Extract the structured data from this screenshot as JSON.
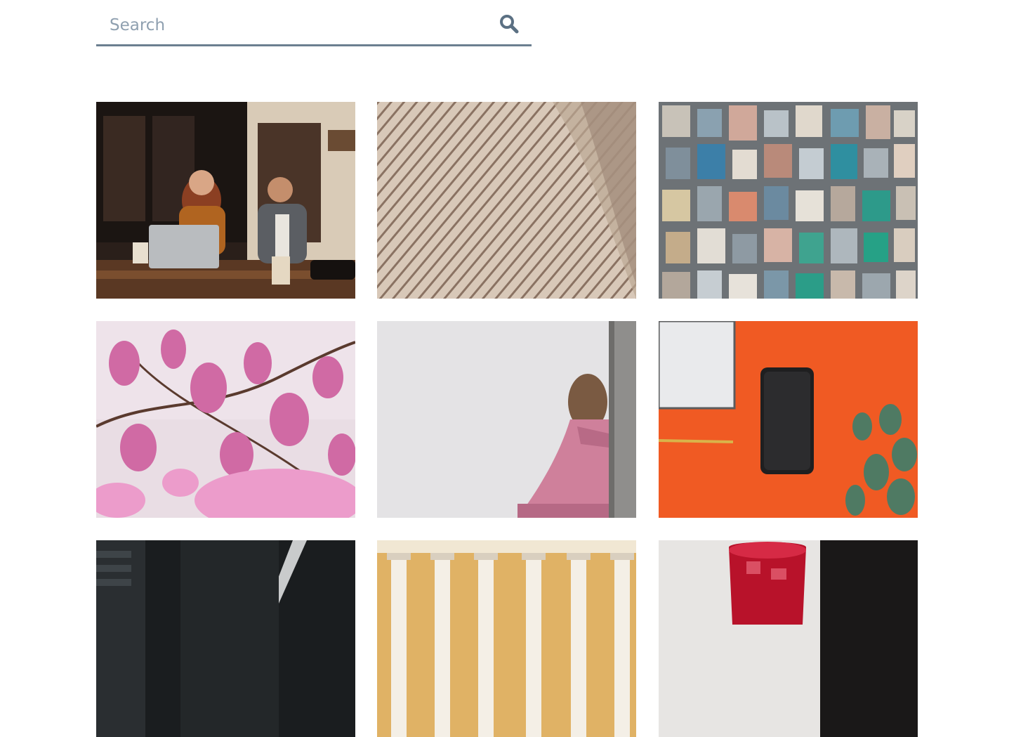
{
  "search": {
    "placeholder": "Search",
    "value": "",
    "icon": "search-icon",
    "accent_color": "#6b7f90"
  },
  "gallery": {
    "photos": [
      {
        "subject": "people-cafe-laptop-photo",
        "icon": "photo-thumbnail"
      },
      {
        "subject": "architecture-lines-photo",
        "icon": "photo-thumbnail"
      },
      {
        "subject": "city-aerial-photo",
        "icon": "photo-thumbnail"
      },
      {
        "subject": "magnolia-flowers-photo",
        "icon": "photo-thumbnail"
      },
      {
        "subject": "girl-wall-art-photo",
        "icon": "photo-thumbnail"
      },
      {
        "subject": "phone-orange-desk-photo",
        "icon": "photo-thumbnail"
      },
      {
        "subject": "dark-interior-photo",
        "icon": "photo-thumbnail"
      },
      {
        "subject": "building-columns-photo",
        "icon": "photo-thumbnail"
      },
      {
        "subject": "red-drink-glass-photo",
        "icon": "photo-thumbnail"
      }
    ]
  }
}
